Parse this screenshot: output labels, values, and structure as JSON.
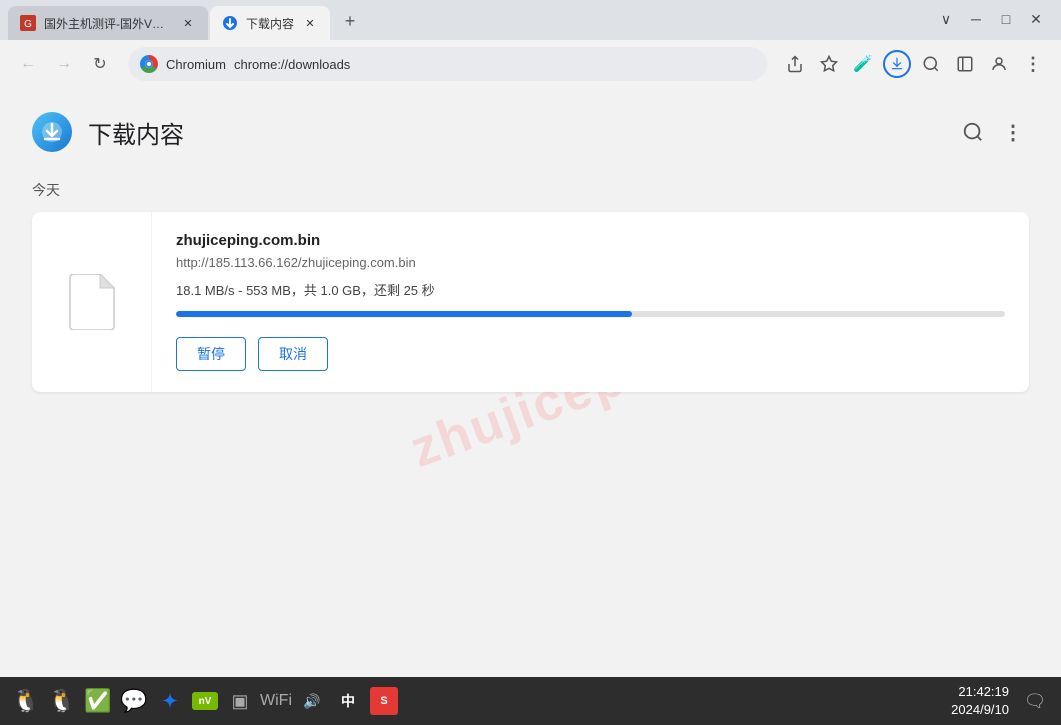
{
  "window": {
    "title": "下载内容",
    "minimize_label": "─",
    "restore_label": "□",
    "close_label": "✕"
  },
  "tabs": [
    {
      "id": "tab1",
      "title": "国外主机测评-国外VPS、国...",
      "favicon": "red",
      "active": false
    },
    {
      "id": "tab2",
      "title": "下载内容",
      "favicon": "download",
      "active": true
    }
  ],
  "new_tab_label": "+",
  "toolbar": {
    "back_label": "←",
    "forward_label": "→",
    "refresh_label": "↻",
    "brand": "Chromium",
    "url": "chrome://downloads",
    "share_icon": "⬆",
    "bookmark_icon": "☆",
    "extensions_icon": "🧪",
    "download_indicator": "⬇",
    "search_icon": "🔍",
    "sidebar_icon": "▣",
    "profile_icon": "👤",
    "more_icon": "⋮"
  },
  "page": {
    "title": "下载内容",
    "section_today": "今天",
    "watermark": "zhujiceping.com",
    "search_icon": "🔍",
    "more_icon": "⋮"
  },
  "download": {
    "filename": "zhujiceping.com.bin",
    "url": "http://185.113.66.162/zhujiceping.com.bin",
    "status": "18.1 MB/s - 553 MB，共 1.0 GB，还剩 25 秒",
    "progress_percent": 55,
    "pause_label": "暂停",
    "cancel_label": "取消"
  },
  "taskbar": {
    "icons": [
      "🐧",
      "🐧",
      "✅",
      "💬",
      "🔵",
      "🟢",
      "📶",
      "🔊",
      "中",
      "🔴"
    ],
    "time": "21:42:19",
    "date": "2024/9/10",
    "notification_icon": "🗨"
  }
}
